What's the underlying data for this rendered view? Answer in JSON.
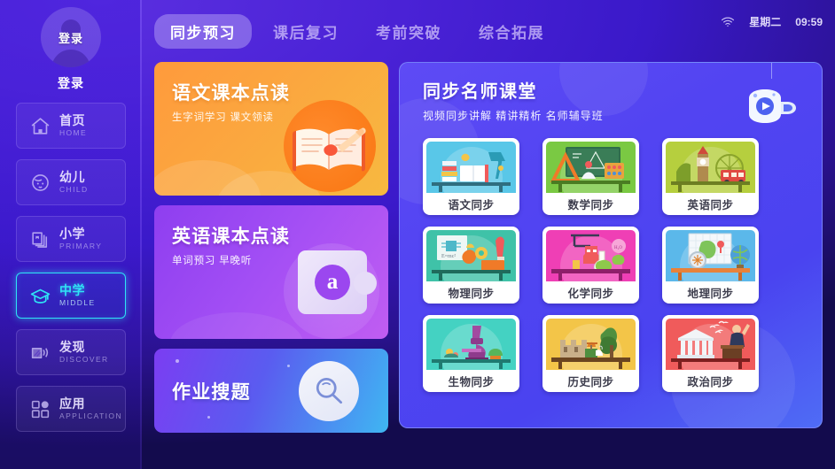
{
  "sidebar": {
    "avatar": {
      "icon": "user-avatar-icon",
      "overlay_text": "登录"
    },
    "login_label": "登录",
    "items": [
      {
        "cn": "首页",
        "en": "HOME",
        "icon": "home-icon",
        "active": false
      },
      {
        "cn": "幼儿",
        "en": "CHILD",
        "icon": "baby-face-icon",
        "active": false
      },
      {
        "cn": "小学",
        "en": "PRIMARY",
        "icon": "books-icon",
        "active": false
      },
      {
        "cn": "中学",
        "en": "MIDDLE",
        "icon": "graduation-cap-icon",
        "active": true
      },
      {
        "cn": "发现",
        "en": "DISCOVER",
        "icon": "discover-icon",
        "active": false
      },
      {
        "cn": "应用",
        "en": "APPLICATION",
        "icon": "apps-grid-icon",
        "active": false
      }
    ]
  },
  "topbar": {
    "tabs": [
      {
        "label": "同步预习",
        "active": true
      },
      {
        "label": "课后复习",
        "active": false
      },
      {
        "label": "考前突破",
        "active": false
      },
      {
        "label": "综合拓展",
        "active": false
      }
    ],
    "status": {
      "wifi_icon": "wifi-icon",
      "weekday": "星期二",
      "time": "09:59"
    }
  },
  "promos": [
    {
      "title": "语文课本点读",
      "subtitle": "生字词学习  课文领读",
      "icon": "open-book-icon",
      "color": "#fba73f"
    },
    {
      "title": "英语课本点读",
      "subtitle": "单词预习  早晚听",
      "icon": "letter-a-card-icon",
      "color": "#a24ef4"
    },
    {
      "title": "作业搜题",
      "subtitle": "",
      "icon": "magnifier-icon",
      "color": "#5a5cf0"
    }
  ],
  "classroom": {
    "title": "同步名师课堂",
    "subtitle": "视频同步讲解  精讲精析  名师辅导班",
    "icon": "projector-video-icon",
    "subjects": [
      {
        "label": "语文同步",
        "icon": "books-lamp-icon",
        "bg": "#59c7e8",
        "desk": "#2f6e80"
      },
      {
        "label": "数学同步",
        "icon": "blackboard-icon",
        "bg": "#7ac943",
        "desk": "#4a7c22"
      },
      {
        "label": "英语同步",
        "icon": "big-ben-bus-icon",
        "bg": "#b6cf3e",
        "desk": "#6d7e22"
      },
      {
        "label": "物理同步",
        "icon": "circuit-gear-icon",
        "bg": "#3fc2a8",
        "desk": "#1f6b5c"
      },
      {
        "label": "化学同步",
        "icon": "flask-icon",
        "bg": "#ef3fb5",
        "desk": "#8e1f6a"
      },
      {
        "label": "地理同步",
        "icon": "map-globe-icon",
        "bg": "#5bb8ea",
        "desk": "#e8823a"
      },
      {
        "label": "生物同步",
        "icon": "microscope-icon",
        "bg": "#44d2c2",
        "desk": "#1f7a70"
      },
      {
        "label": "历史同步",
        "icon": "great-wall-icon",
        "bg": "#f3c548",
        "desk": "#6b4520"
      },
      {
        "label": "政治同步",
        "icon": "temple-speaker-icon",
        "bg": "#f05b5b",
        "desk": "#7d1f1f"
      }
    ]
  }
}
